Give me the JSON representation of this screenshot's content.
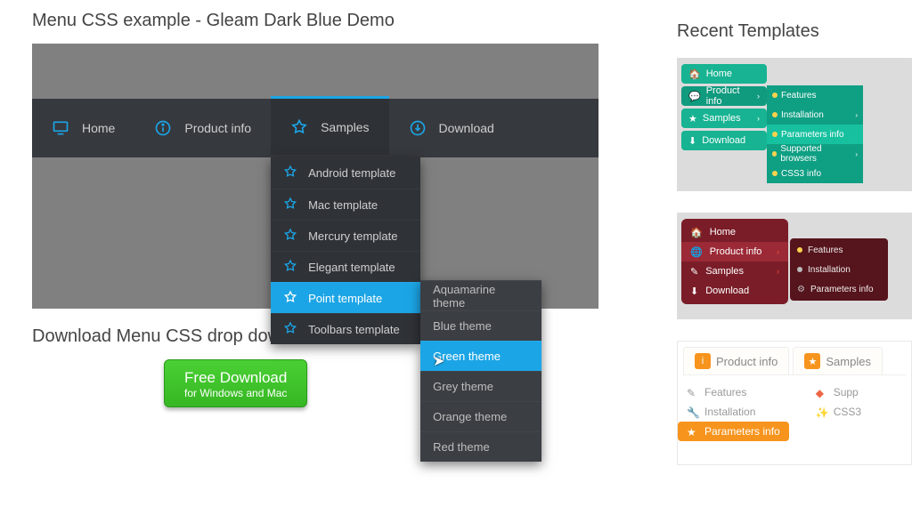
{
  "page": {
    "title": "Menu CSS example - Gleam Dark Blue Demo",
    "download_heading": "Download Menu CSS drop down",
    "recent_heading": "Recent Templates"
  },
  "menu": {
    "items": [
      {
        "label": "Home",
        "icon": "monitor"
      },
      {
        "label": "Product info",
        "icon": "info"
      },
      {
        "label": "Samples",
        "icon": "star",
        "selected": true
      },
      {
        "label": "Download",
        "icon": "download"
      }
    ],
    "samples_dropdown": [
      "Android template",
      "Mac template",
      "Mercury template",
      "Elegant template",
      "Point template",
      "Toolbars template"
    ],
    "samples_selected_index": 4,
    "point_submenu": [
      "Aquamarine theme",
      "Blue theme",
      "Green theme",
      "Grey theme",
      "Orange theme",
      "Red theme"
    ],
    "point_selected_index": 2
  },
  "download_button": {
    "line1": "Free Download",
    "line2": "for Windows and Mac"
  },
  "sidebar": {
    "teal": {
      "items": [
        "Home",
        "Product info",
        "Samples",
        "Download"
      ],
      "sub": [
        "Features",
        "Installation",
        "Parameters info",
        "Supported browsers",
        "CSS3 info"
      ],
      "sub_selected_index": 2
    },
    "maroon": {
      "items": [
        "Home",
        "Product info",
        "Samples",
        "Download"
      ],
      "selected_index": 1,
      "sub": [
        "Features",
        "Installation",
        "Parameters info"
      ]
    },
    "orange": {
      "tabs": [
        "Product info",
        "Samples"
      ],
      "col1": [
        "Features",
        "Installation",
        "Parameters info"
      ],
      "col1_selected_index": 2,
      "col2": [
        "Supp",
        "CSS3"
      ]
    }
  }
}
